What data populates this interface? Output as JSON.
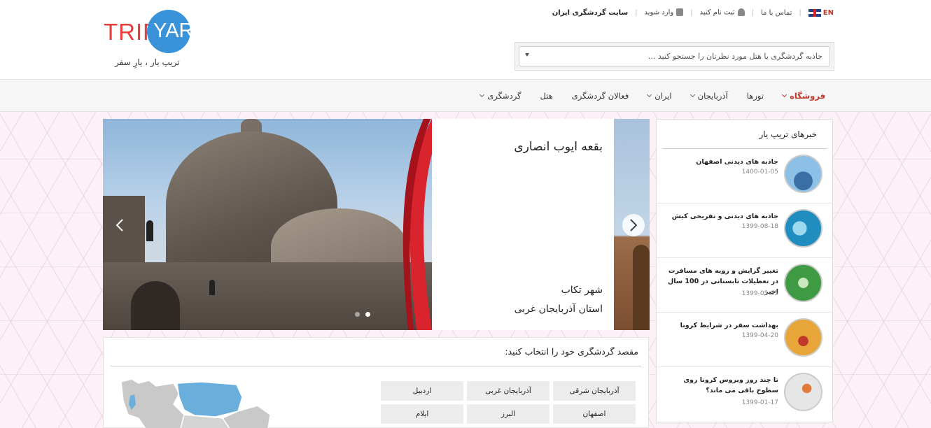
{
  "header": {
    "logo_trip": "TRIP",
    "logo_yar": "YAR",
    "logo_tagline": "تریپ یار ، یارِ سفر",
    "top_links": {
      "site": "سایت گردشگری ایران",
      "login": "وارد شوید",
      "register": "ثبت نام کنید",
      "contact": "تماس با ما",
      "lang": "EN"
    },
    "search_placeholder": "جاذبه گردشگری یا هتل مورد نظرتان را جستجو کنید ..."
  },
  "nav": {
    "items": [
      {
        "label": "گردشگری",
        "dropdown": true
      },
      {
        "label": "هتل",
        "dropdown": false
      },
      {
        "label": "فعالان گردشگری",
        "dropdown": false
      },
      {
        "label": "ایران",
        "dropdown": true
      },
      {
        "label": "آذربایجان",
        "dropdown": true
      },
      {
        "label": "تورها",
        "dropdown": false
      },
      {
        "label": "فروشگاه",
        "dropdown": true
      }
    ]
  },
  "slider": {
    "title": "بقعه ایوب انصاری",
    "city": "شهر تکاب",
    "province": "استان آذربایجان غربی",
    "dot_count": 2,
    "active_dot": 2
  },
  "destination": {
    "title": "مقصد گردشگری خود را انتخاب کنید:",
    "provinces": [
      "آذربایجان شرقی",
      "آذربایجان غربی",
      "اردبیل",
      "اصفهان",
      "البرز",
      "ایلام"
    ]
  },
  "news": {
    "title": "خبرهای تریپ یار",
    "items": [
      {
        "headline": "جاذبه های دیدنی اصفهان",
        "date": "1400-01-05",
        "thumb_color": "#7fb2dc"
      },
      {
        "headline": "جاذبه های دیدنی و تفریحی کیش",
        "date": "1399-08-18",
        "thumb_color": "#2a9bc8"
      },
      {
        "headline": "تغییر گرایش و رویه های مسافرت در تعطیلات تابستانی در 100 سال اخیر",
        "date": "1399-05-05",
        "thumb_color": "#4aa34a"
      },
      {
        "headline": "بهداشت سفر در شرایط کرونا",
        "date": "1399-04-20",
        "thumb_color": "#e8a63a"
      },
      {
        "headline": "تا چند روز ویروس کرونا روی سطوح باقی می ماند؟",
        "date": "1399-01-17",
        "thumb_color": "#d9d9d9"
      }
    ]
  },
  "colors": {
    "brand_red": "#e63d3d",
    "brand_blue": "#3a93d8",
    "shop_red": "#c0392b",
    "map_selected": "#6aaedb",
    "map_default": "#c9c9c9"
  }
}
